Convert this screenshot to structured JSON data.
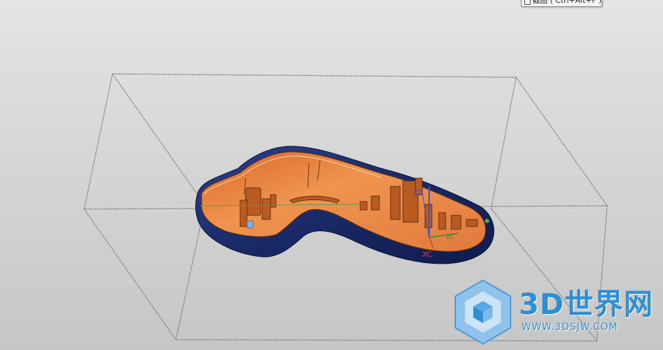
{
  "tooltip": {
    "text": "截图 ( Ctrl+Alt+F )",
    "icon": "screenshot-icon"
  },
  "triad": {
    "x_label": "XC",
    "y_label": "YC",
    "z_label": "ZC"
  },
  "watermark": {
    "title": "3D世界网",
    "url": "WWW.3DSJW.COM",
    "icon": "cube-logo-icon"
  },
  "colors": {
    "background_top": "#e4e4e4",
    "background_bottom": "#c6c6c6",
    "part_outer": "#1e2f6e",
    "part_inner": "#e0783a",
    "bounding_box": "#7a7a7a",
    "watermark": "#2f8fd3"
  }
}
